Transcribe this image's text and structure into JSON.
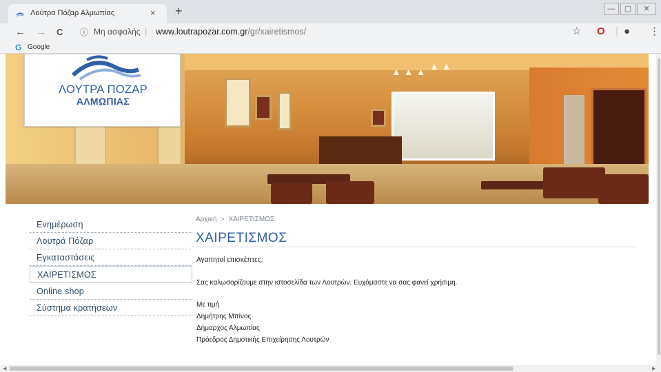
{
  "browser": {
    "tab_title": "Λούτρα Πόζαρ Αλμωπίας",
    "tab_close": "×",
    "new_tab": "+",
    "window_controls": [
      "—",
      "▢",
      "✕"
    ],
    "nav": {
      "back": "←",
      "forward": "→",
      "reload": "C"
    },
    "security_label": "Μη ασφαλής",
    "url_host": "www.loutrapozar.com.gr",
    "url_path": "/gr/xairetismos/",
    "bookmark_label": "Google"
  },
  "logo": {
    "line1": "ΛΟΥΤΡΑ ΠΟΖΑΡ",
    "line2": "ΑΛΜΩΠΙΑΣ"
  },
  "sidebar": {
    "items": [
      {
        "label": "Ενημέρωση"
      },
      {
        "label": "Λουτρά Πόζαρ"
      },
      {
        "label": "Εγκαταστάσεις"
      },
      {
        "label": "ΧΑΙΡΕΤΙΣΜΟΣ",
        "active": true
      },
      {
        "label": "Online shop"
      },
      {
        "label": "Σύστημα κρατήσεων"
      }
    ]
  },
  "content": {
    "breadcrumb": {
      "home": "Αρχική",
      "sep": ">",
      "current": "ΧΑΙΡΕΤΙΣΜΟΣ"
    },
    "title": "ΧΑΙΡΕΤΙΣΜΟΣ",
    "greeting": "Αγαπητοί επισκέπτες,",
    "welcome": "Σας καλωσορίζουμε στην ιστοσελίδα των Λουτρών. Ευχόμαστε να σας φανεί χρήσιμη.",
    "signoff": "Με τιμή",
    "name": "Δημήτρης Μπίνος",
    "role1": "Δήμαρχος Αλμωπίας",
    "role2": "Πρόεδρος Δημοτικής Επιχείρησης Λουτρών"
  },
  "colors": {
    "brand_blue": "#2f5fa6",
    "nav_text": "#2e4a66",
    "opera_red": "#d7262b"
  }
}
